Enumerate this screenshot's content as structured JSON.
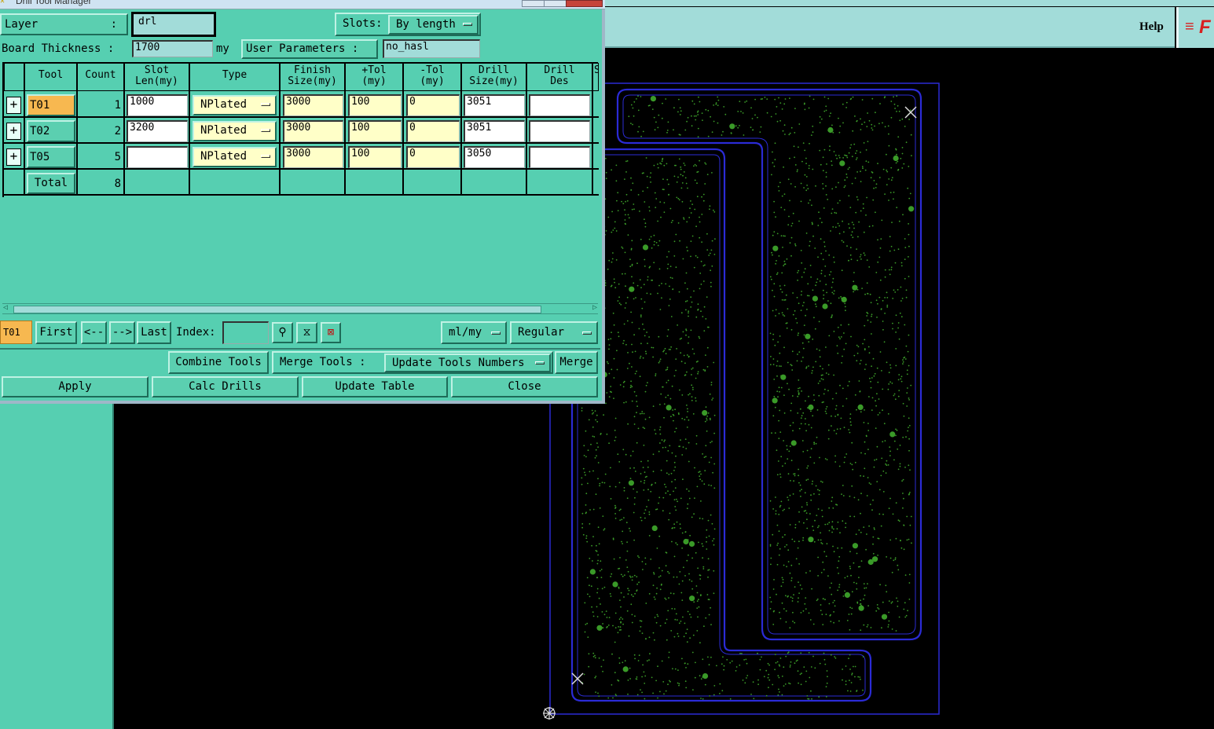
{
  "window": {
    "title": "Drill Tool Manager"
  },
  "colors": {
    "panel": "#56cfb1",
    "teal_light": "#a2dcd9",
    "highlight": "#f7b850",
    "field_yellow": "#ffffc8",
    "board_outline": "#2b2bd6",
    "drill_green": "#3a9a28"
  },
  "app": {
    "help_label": "Help",
    "logo_text": "F"
  },
  "top": {
    "layer_label": "Layer",
    "layer_sep": ":",
    "layer_value": "drl",
    "slots_label": "Slots:",
    "slots_value": "By length",
    "thickness_label": "Board Thickness :",
    "thickness_value": "1700",
    "thickness_unit": "my",
    "user_params_label": "User Parameters :",
    "user_params_value": "no_hasl"
  },
  "table": {
    "headers": {
      "tool": "Tool",
      "count": "Count",
      "slot1": "Slot",
      "slot2": "Len(my)",
      "type": "Type",
      "finish1": "Finish",
      "finish2": "Size(my)",
      "ptol1": "+Tol",
      "ptol2": "(my)",
      "mtol1": "-Tol",
      "mtol2": "(my)",
      "drill1": "Drill",
      "drill2": "Size(my)",
      "des1": "Drill",
      "des2": "Des",
      "more": "S"
    },
    "rows": [
      {
        "tool": "T01",
        "count": "1",
        "slot": "1000",
        "type": "NPlated",
        "finish": "3000",
        "ptol": "100",
        "mtol": "0",
        "drill": "3051",
        "des": ""
      },
      {
        "tool": "T02",
        "count": "2",
        "slot": "3200",
        "type": "NPlated",
        "finish": "3000",
        "ptol": "100",
        "mtol": "0",
        "drill": "3051",
        "des": ""
      },
      {
        "tool": "T05",
        "count": "5",
        "slot": "",
        "type": "NPlated",
        "finish": "3000",
        "ptol": "100",
        "mtol": "0",
        "drill": "3050",
        "des": ""
      }
    ],
    "total": {
      "label": "Total",
      "count": "8"
    }
  },
  "nav": {
    "current": "T01",
    "first": "First",
    "prev": "<--",
    "next": "-->",
    "last": "Last",
    "index_label": "Index:",
    "index_value": "",
    "units": "ml/my",
    "mode": "Regular"
  },
  "tools": {
    "combine": "Combine Tools",
    "merge_label": "Merge Tools :",
    "merge_option": "Update Tools Numbers",
    "merge": "Merge"
  },
  "actions": {
    "apply": "Apply",
    "calc": "Calc Drills",
    "update": "Update Table",
    "close": "Close"
  }
}
